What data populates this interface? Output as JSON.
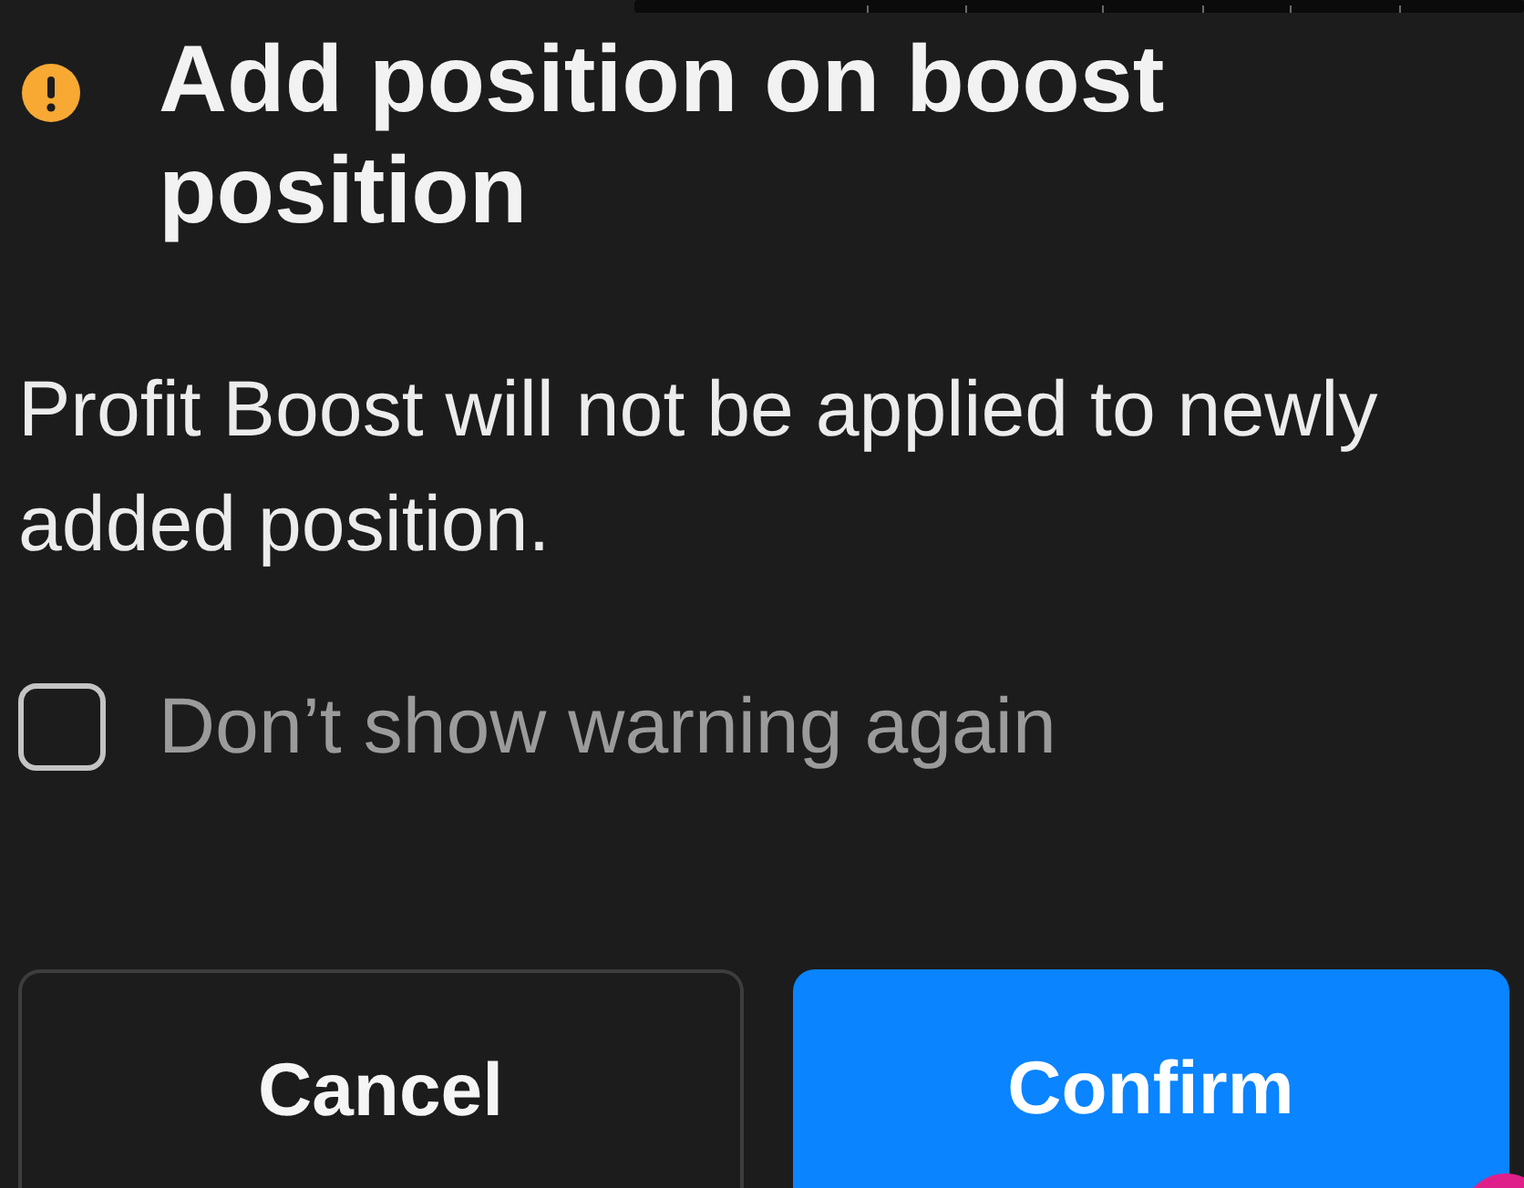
{
  "dialog": {
    "title": "Add position on boost position",
    "message": "Profit Boost will not be applied to newly added position.",
    "checkbox": {
      "label": "Don’t show warning again",
      "checked": false
    },
    "buttons": [
      {
        "label": "Cancel",
        "kind": "secondary"
      },
      {
        "label": "Confirm",
        "kind": "primary"
      }
    ]
  }
}
